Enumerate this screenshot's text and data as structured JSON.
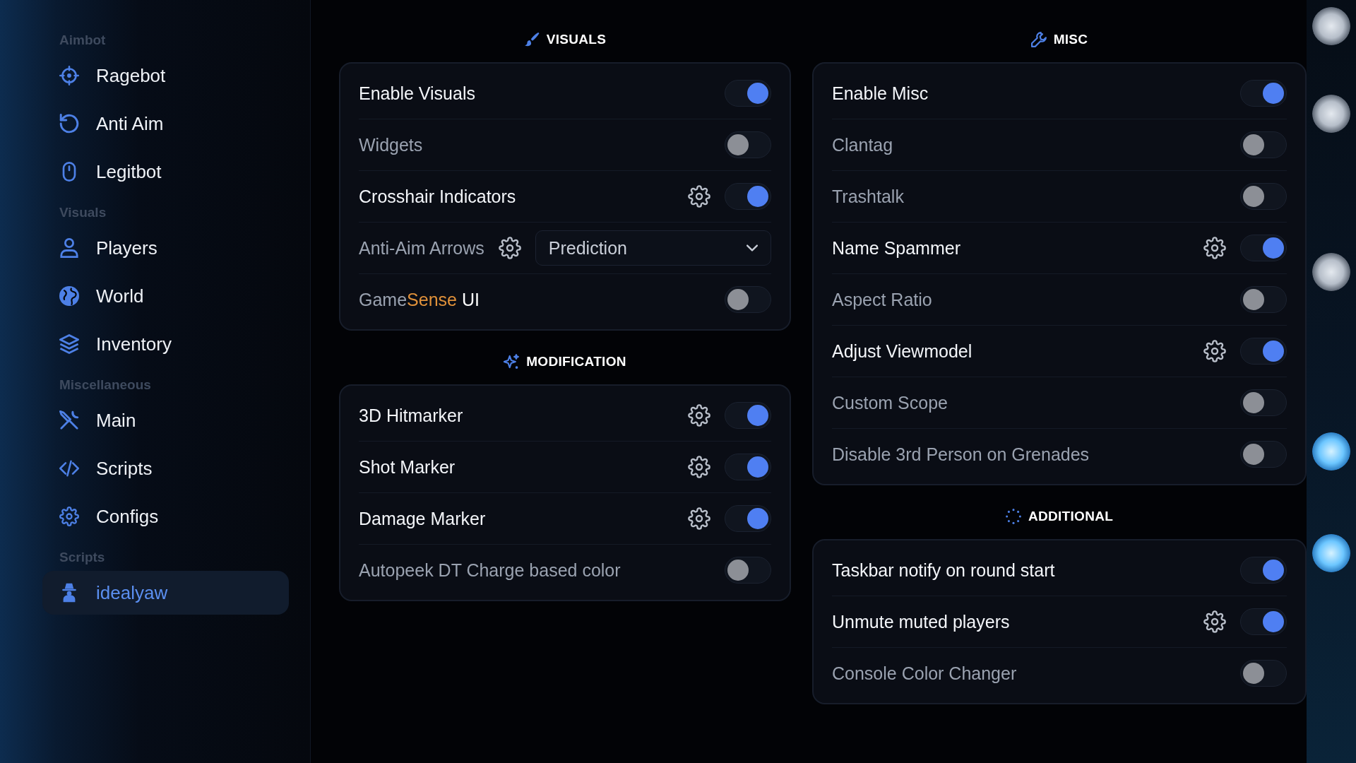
{
  "sidebar": {
    "sections": [
      {
        "title": "Aimbot",
        "items": [
          {
            "label": "Ragebot",
            "selected": false
          },
          {
            "label": "Anti Aim",
            "selected": false
          },
          {
            "label": "Legitbot",
            "selected": false
          }
        ]
      },
      {
        "title": "Visuals",
        "items": [
          {
            "label": "Players",
            "selected": false
          },
          {
            "label": "World",
            "selected": false
          },
          {
            "label": "Inventory",
            "selected": false
          }
        ]
      },
      {
        "title": "Miscellaneous",
        "items": [
          {
            "label": "Main",
            "selected": false
          },
          {
            "label": "Scripts",
            "selected": false
          },
          {
            "label": "Configs",
            "selected": false
          }
        ]
      },
      {
        "title": "Scripts",
        "items": [
          {
            "label": "idealyaw",
            "selected": true
          }
        ]
      }
    ]
  },
  "columns": [
    {
      "groups": [
        {
          "title": "VISUALS",
          "rows": [
            {
              "kind": "toggle",
              "label": "Enable Visuals",
              "settings": false,
              "on": true
            },
            {
              "kind": "toggle",
              "label": "Widgets",
              "settings": false,
              "on": false
            },
            {
              "kind": "toggle",
              "label": "Crosshair Indicators",
              "settings": true,
              "on": true
            },
            {
              "kind": "dropdown",
              "label": "Anti-Aim Arrows",
              "settings": true,
              "value": "Prediction"
            },
            {
              "kind": "toggle",
              "label_parts": [
                {
                  "text": "Game",
                  "color": "#9aa2b0"
                },
                {
                  "text": "Sense",
                  "color": "#e0913a"
                },
                {
                  "text": " UI",
                  "color": "#ffffff"
                }
              ],
              "settings": false,
              "on": false
            }
          ]
        },
        {
          "title": "MODIFICATION",
          "rows": [
            {
              "kind": "toggle",
              "label": "3D Hitmarker",
              "settings": true,
              "on": true
            },
            {
              "kind": "toggle",
              "label": "Shot Marker",
              "settings": true,
              "on": true
            },
            {
              "kind": "toggle",
              "label": "Damage Marker",
              "settings": true,
              "on": true
            },
            {
              "kind": "toggle",
              "label": "Autopeek DT Charge based color",
              "settings": false,
              "on": false
            }
          ]
        }
      ]
    },
    {
      "groups": [
        {
          "title": "MISC",
          "rows": [
            {
              "kind": "toggle",
              "label": "Enable Misc",
              "settings": false,
              "on": true
            },
            {
              "kind": "toggle",
              "label": "Clantag",
              "settings": false,
              "on": false
            },
            {
              "kind": "toggle",
              "label": "Trashtalk",
              "settings": false,
              "on": false
            },
            {
              "kind": "toggle",
              "label": "Name Spammer",
              "settings": true,
              "on": true
            },
            {
              "kind": "toggle",
              "label": "Aspect Ratio",
              "settings": false,
              "on": false
            },
            {
              "kind": "toggle",
              "label": "Adjust Viewmodel",
              "settings": true,
              "on": true
            },
            {
              "kind": "toggle",
              "label": "Custom Scope",
              "settings": false,
              "on": false
            },
            {
              "kind": "toggle",
              "label": "Disable 3rd Person on Grenades",
              "settings": false,
              "on": false
            }
          ]
        },
        {
          "title": "ADDITIONAL",
          "rows": [
            {
              "kind": "toggle",
              "label": "Taskbar notify on round start",
              "settings": false,
              "on": true
            },
            {
              "kind": "toggle",
              "label": "Unmute muted players",
              "settings": true,
              "on": true
            },
            {
              "kind": "toggle",
              "label": "Console Color Changer",
              "settings": false,
              "on": false
            }
          ]
        }
      ]
    }
  ]
}
